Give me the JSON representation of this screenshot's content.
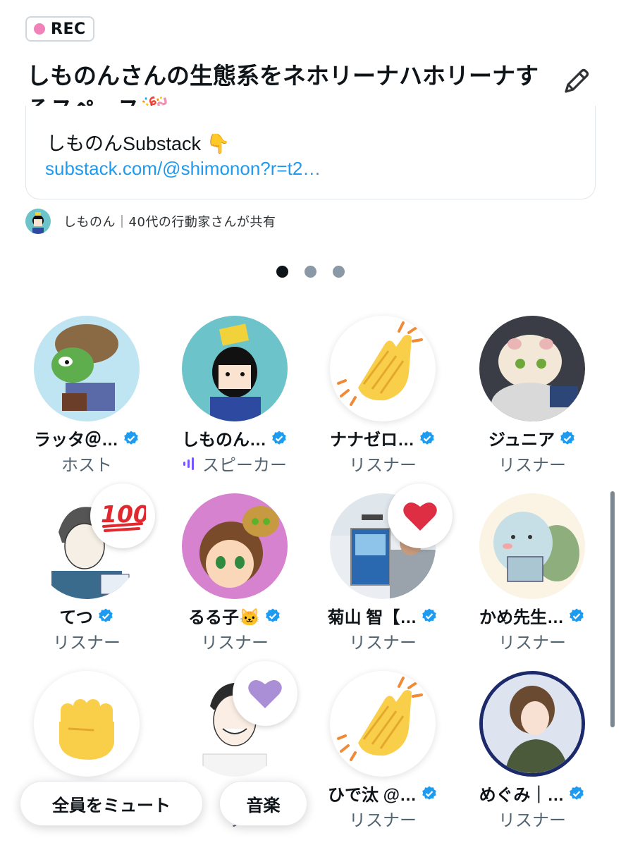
{
  "rec": {
    "label": "REC"
  },
  "space": {
    "title": "しものんさんの生態系をネホリーナハホリーナするスペース🎉"
  },
  "card": {
    "title": "しものんSubstack 👇",
    "url": "substack.com/@shimonon?r=t2…"
  },
  "shared": {
    "text": "しものん｜40代の行動家さんが共有"
  },
  "pagination": {
    "total": 3,
    "active": 0
  },
  "participants": [
    {
      "name": "ラッタ＠…",
      "role": "ホスト",
      "verified": true
    },
    {
      "name": "しものん…",
      "role": "スピーカー",
      "verified": true,
      "speaking": true
    },
    {
      "name": "ナナゼロ…",
      "role": "リスナー",
      "verified": true
    },
    {
      "name": "ジュニア",
      "role": "リスナー",
      "verified": true
    },
    {
      "name": "てつ",
      "role": "リスナー",
      "verified": true,
      "reaction": "hundred-points"
    },
    {
      "name": "るる子🐱",
      "role": "リスナー",
      "verified": true
    },
    {
      "name": "菊山 智【…",
      "role": "リスナー",
      "verified": true,
      "reaction": "red-heart"
    },
    {
      "name": "かめ先生…",
      "role": "リスナー",
      "verified": true
    },
    {
      "name": "",
      "role": "",
      "verified": false,
      "reaction": "raised-fist"
    },
    {
      "name": "く",
      "role": "リ",
      "verified": false,
      "reaction": "purple-heart"
    },
    {
      "name": "ひで汰 @…",
      "role": "リスナー",
      "verified": true
    },
    {
      "name": "めぐみ｜…",
      "role": "リスナー",
      "verified": true
    }
  ],
  "actions": {
    "mute_all": "全員をミュート",
    "music": "音楽"
  },
  "colors": {
    "accent": "#1d9bf0",
    "rec_dot": "#f081b9",
    "verified": "#1d9bf0",
    "speaker_bars": "#7856ff"
  }
}
